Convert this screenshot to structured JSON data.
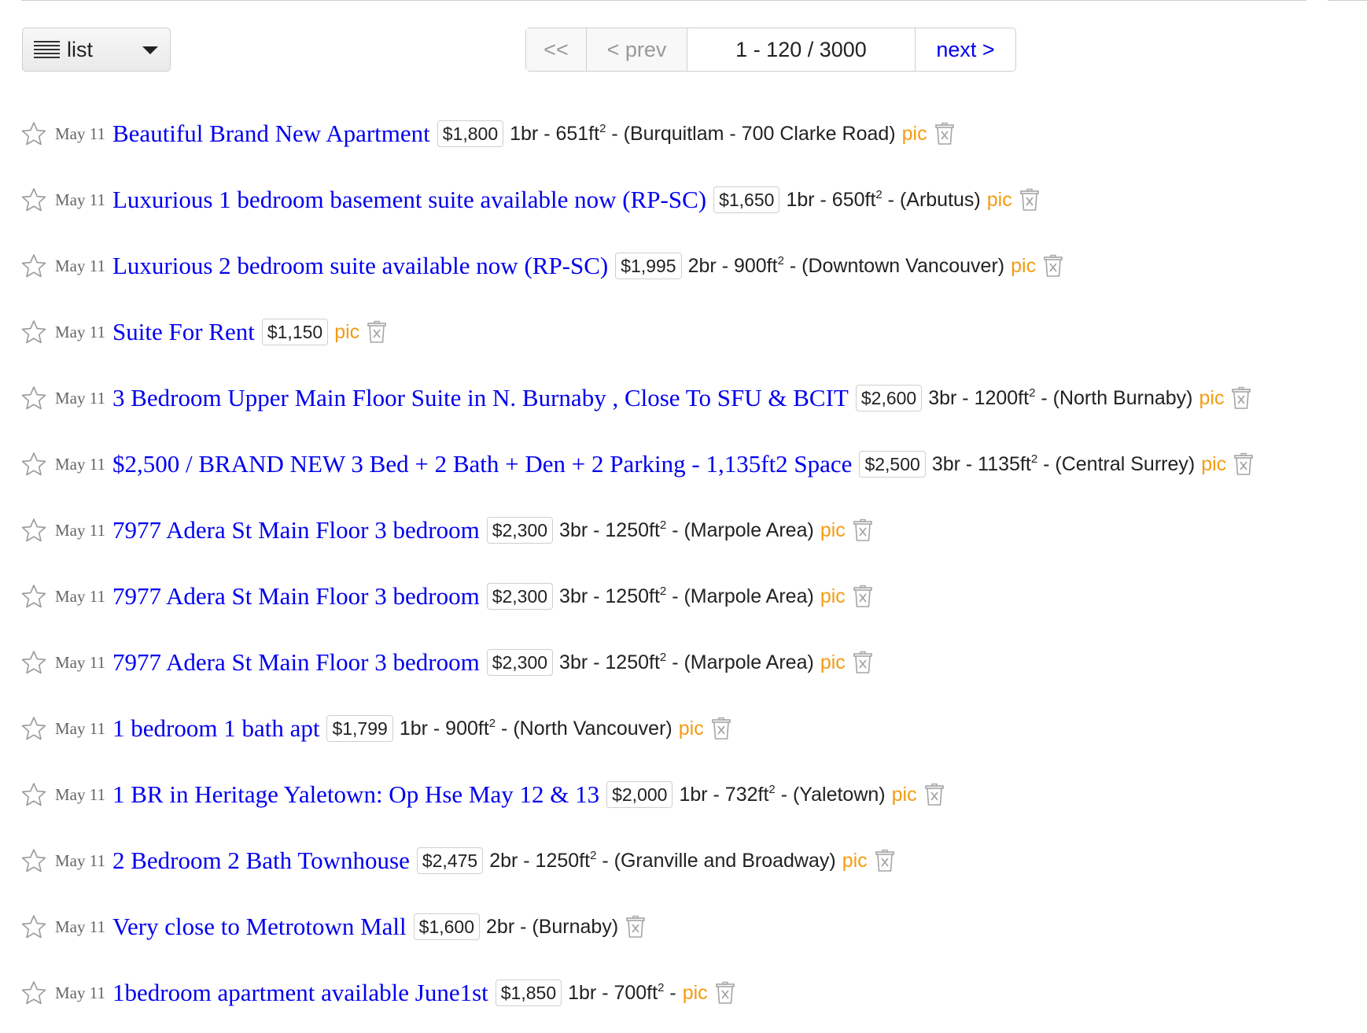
{
  "view_select": {
    "label": "list",
    "icon": "list-icon"
  },
  "pager": {
    "first": "<<",
    "prev": "< prev",
    "range": "1 - 120 / 3000",
    "next": "next >"
  },
  "colors": {
    "link": "#0000ee",
    "pic": "#f39c12",
    "date": "#666666"
  },
  "listings": [
    {
      "date": "May 11",
      "title": "Beautiful Brand New Apartment",
      "price": "$1,800",
      "housing": "1br - 651ft",
      "location": "(Burquitlam - 700 Clarke Road)",
      "pic": "pic"
    },
    {
      "date": "May 11",
      "title": "Luxurious 1 bedroom basement suite available now (RP-SC)",
      "price": "$1,650",
      "housing": "1br - 650ft",
      "location": "(Arbutus)",
      "pic": "pic"
    },
    {
      "date": "May 11",
      "title": "Luxurious 2 bedroom suite available now (RP-SC)",
      "price": "$1,995",
      "housing": "2br - 900ft",
      "location": "(Downtown Vancouver)",
      "pic": "pic"
    },
    {
      "date": "May 11",
      "title": "Suite For Rent",
      "price": "$1,150",
      "housing": "",
      "location": "",
      "pic": "pic"
    },
    {
      "date": "May 11",
      "title": "3 Bedroom Upper Main Floor Suite in N. Burnaby , Close To SFU & BCIT",
      "price": "$2,600",
      "housing": "3br - 1200ft",
      "location": "(North Burnaby)",
      "pic": "pic"
    },
    {
      "date": "May 11",
      "title": "$2,500 / BRAND NEW 3 Bed + 2 Bath + Den + 2 Parking - 1,135ft2 Space",
      "price": "$2,500",
      "housing": "3br - 1135ft",
      "location": "(Central Surrey)",
      "pic": "pic"
    },
    {
      "date": "May 11",
      "title": "7977 Adera St Main Floor 3 bedroom",
      "price": "$2,300",
      "housing": "3br - 1250ft",
      "location": "(Marpole Area)",
      "pic": "pic"
    },
    {
      "date": "May 11",
      "title": "7977 Adera St Main Floor 3 bedroom",
      "price": "$2,300",
      "housing": "3br - 1250ft",
      "location": "(Marpole Area)",
      "pic": "pic"
    },
    {
      "date": "May 11",
      "title": "7977 Adera St Main Floor 3 bedroom",
      "price": "$2,300",
      "housing": "3br - 1250ft",
      "location": "(Marpole Area)",
      "pic": "pic"
    },
    {
      "date": "May 11",
      "title": "1 bedroom 1 bath apt",
      "price": "$1,799",
      "housing": "1br - 900ft",
      "location": "(North Vancouver)",
      "pic": "pic"
    },
    {
      "date": "May 11",
      "title": "1 BR in Heritage Yaletown: Op Hse May 12 & 13",
      "price": "$2,000",
      "housing": "1br - 732ft",
      "location": "(Yaletown)",
      "pic": "pic"
    },
    {
      "date": "May 11",
      "title": "2 Bedroom 2 Bath Townhouse",
      "price": "$2,475",
      "housing": "2br - 1250ft",
      "location": "(Granville and Broadway)",
      "pic": "pic"
    },
    {
      "date": "May 11",
      "title": "Very close to Metrotown Mall",
      "price": "$1,600",
      "housing": "2br",
      "location": "(Burnaby)",
      "pic": ""
    },
    {
      "date": "May 11",
      "title": "1bedroom apartment available June1st",
      "price": "$1,850",
      "housing": "1br - 700ft",
      "location": "",
      "pic": "pic"
    }
  ]
}
